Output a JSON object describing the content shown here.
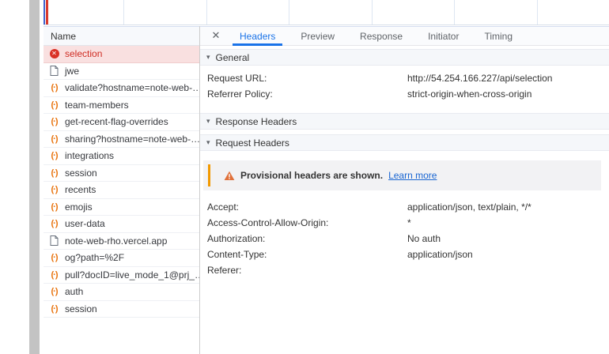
{
  "icons": {
    "close": "✕",
    "collapse_triangle": "▾",
    "fetch_glyph": "(·)",
    "error_glyph": "✕"
  },
  "colors": {
    "accent_blue": "#1a73e8",
    "error_red": "#d93025",
    "fetch_orange": "#e8710a",
    "warning_orange": "#f29900",
    "link_blue": "#1a66d2",
    "selected_error_row_bg": "#f9e0e0"
  },
  "overview": {
    "dcl_marker": "blue",
    "load_marker": "red",
    "gridlines_x": [
      101,
      206,
      310,
      415,
      519,
      624
    ]
  },
  "request_list": {
    "column_header": "Name",
    "rows": [
      {
        "name": "selection",
        "icon": "error",
        "selected": true
      },
      {
        "name": "jwe",
        "icon": "document"
      },
      {
        "name": "validate?hostname=note-web-…",
        "icon": "fetch"
      },
      {
        "name": "team-members",
        "icon": "fetch"
      },
      {
        "name": "get-recent-flag-overrides",
        "icon": "fetch"
      },
      {
        "name": "sharing?hostname=note-web-…",
        "icon": "fetch"
      },
      {
        "name": "integrations",
        "icon": "fetch"
      },
      {
        "name": "session",
        "icon": "fetch"
      },
      {
        "name": "recents",
        "icon": "fetch"
      },
      {
        "name": "emojis",
        "icon": "fetch"
      },
      {
        "name": "user-data",
        "icon": "fetch"
      },
      {
        "name": "note-web-rho.vercel.app",
        "icon": "document"
      },
      {
        "name": "og?path=%2F",
        "icon": "fetch"
      },
      {
        "name": "pull?docID=live_mode_1@prj_…",
        "icon": "fetch"
      },
      {
        "name": "auth",
        "icon": "fetch"
      },
      {
        "name": "session",
        "icon": "fetch"
      }
    ]
  },
  "details": {
    "tabs": [
      "Headers",
      "Preview",
      "Response",
      "Initiator",
      "Timing"
    ],
    "active_tab": "Headers",
    "sections": [
      {
        "title": "General",
        "rows": [
          {
            "key": "Request URL:",
            "value": "http://54.254.166.227/api/selection"
          },
          {
            "key": "Referrer Policy:",
            "value": "strict-origin-when-cross-origin"
          }
        ]
      },
      {
        "title": "Response Headers",
        "rows": []
      },
      {
        "title": "Request Headers",
        "warning": {
          "text": "Provisional headers are shown.",
          "link": "Learn more"
        },
        "rows": [
          {
            "key": "Accept:",
            "value": "application/json, text/plain, */*"
          },
          {
            "key": "Access-Control-Allow-Origin:",
            "value": "*"
          },
          {
            "key": "Authorization:",
            "value": "No auth"
          },
          {
            "key": "Content-Type:",
            "value": "application/json"
          },
          {
            "key": "Referer:",
            "value": ""
          }
        ]
      }
    ]
  }
}
